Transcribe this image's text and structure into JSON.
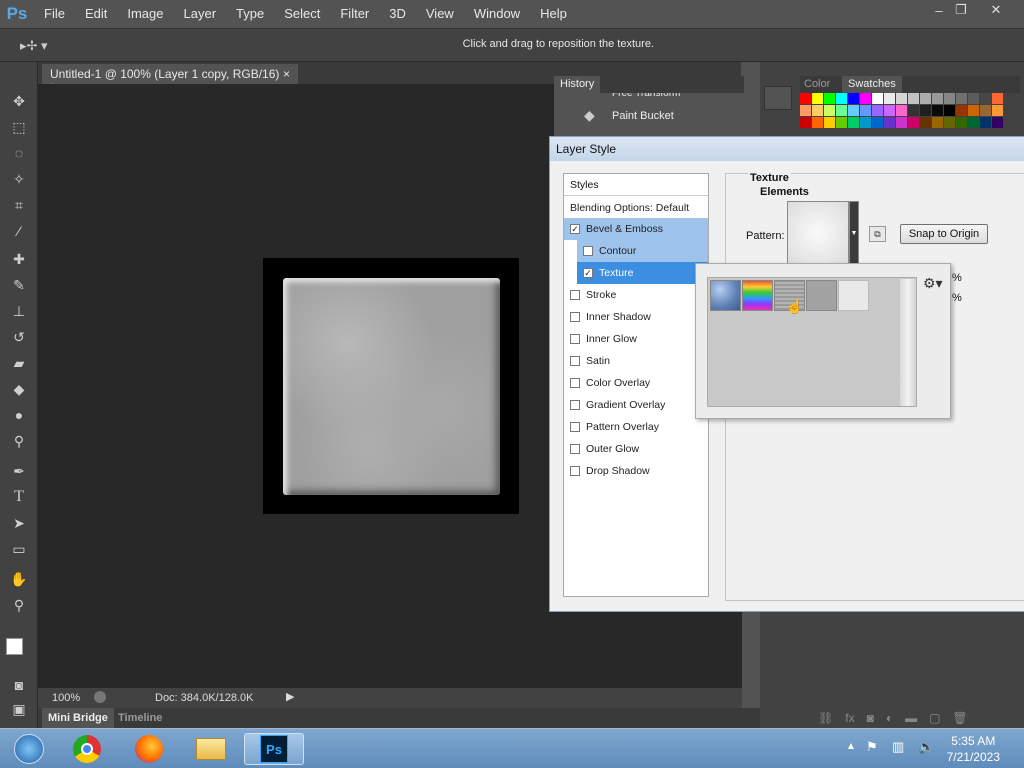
{
  "app": {
    "logo": "Ps"
  },
  "menu": [
    "File",
    "Edit",
    "Image",
    "Layer",
    "Type",
    "Select",
    "Filter",
    "3D",
    "View",
    "Window",
    "Help"
  ],
  "window_buttons": {
    "minimize": "–",
    "restore": "❐",
    "close": "✕"
  },
  "options_bar": {
    "hint": "Click and drag to reposition the texture."
  },
  "document": {
    "tab_title": "Untitled-1 @ 100% (Layer 1 copy, RGB/16) *",
    "tab_close": "×",
    "zoom": "100%",
    "doc_size": "Doc: 384.0K/128.0K"
  },
  "bottom_tabs": {
    "mini_bridge": "Mini Bridge",
    "timeline": "Timeline"
  },
  "history_panel": {
    "tab": "History",
    "items": [
      {
        "label": "Free Transform"
      },
      {
        "label": "Paint Bucket"
      }
    ]
  },
  "swatch_panel": {
    "tabs": [
      "Color",
      "Swatches"
    ],
    "colors": [
      "#ff0000",
      "#ffff00",
      "#00ff00",
      "#00ffff",
      "#0000ff",
      "#ff00ff",
      "#ffffff",
      "#ebebeb",
      "#d6d6d6",
      "#c2c2c2",
      "#adadad",
      "#999999",
      "#858585",
      "#707070",
      "#5c5c5c",
      "#474747",
      "#ff6633",
      "#ff9966",
      "#ffcc66",
      "#ccff66",
      "#66ff99",
      "#66ccff",
      "#6699ff",
      "#9966ff",
      "#cc66ff",
      "#ff66cc",
      "#333333",
      "#1f1f1f",
      "#0a0a0a",
      "#000000",
      "#993300",
      "#cc6600",
      "#996633",
      "#ff9933",
      "#cc0000",
      "#ff6600",
      "#ffcc00",
      "#66cc00",
      "#00cc66",
      "#0099cc",
      "#0066cc",
      "#6633cc",
      "#cc33cc",
      "#cc0066",
      "#663300",
      "#996600",
      "#666600",
      "#336600",
      "#006633",
      "#003366",
      "#330066"
    ]
  },
  "dialog": {
    "title": "Layer Style",
    "styles_header": "Styles",
    "blending": "Blending Options: Default",
    "items": [
      {
        "label": "Bevel & Emboss",
        "checked": true
      },
      {
        "label": "Contour",
        "checked": false
      },
      {
        "label": "Texture",
        "checked": true
      },
      {
        "label": "Stroke",
        "checked": false
      },
      {
        "label": "Inner Shadow",
        "checked": false
      },
      {
        "label": "Inner Glow",
        "checked": false
      },
      {
        "label": "Satin",
        "checked": false
      },
      {
        "label": "Color Overlay",
        "checked": false
      },
      {
        "label": "Gradient Overlay",
        "checked": false
      },
      {
        "label": "Pattern Overlay",
        "checked": false
      },
      {
        "label": "Outer Glow",
        "checked": false
      },
      {
        "label": "Drop Shadow",
        "checked": false
      }
    ],
    "texture_heading": "Texture",
    "elements_heading": "Elements",
    "pattern_label": "Pattern:",
    "snap_button": "Snap to Origin",
    "percent1": "%",
    "percent2": "%"
  },
  "taskbar": {
    "time": "5:35 AM",
    "date": "7/21/2023"
  }
}
